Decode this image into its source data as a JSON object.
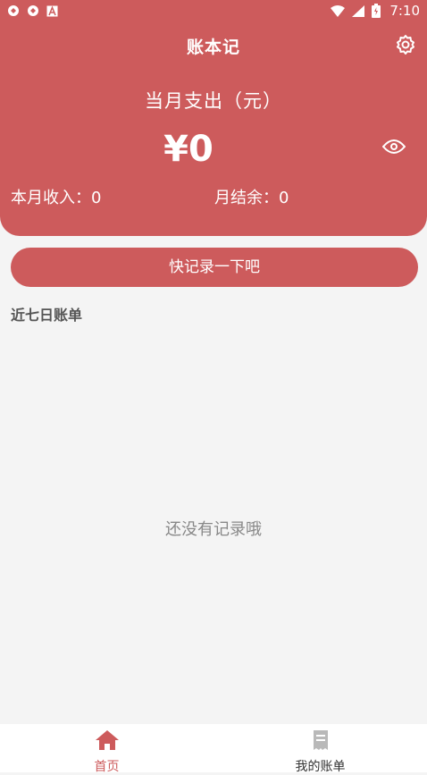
{
  "status_bar": {
    "time": "7:10",
    "left_icons": [
      "sync-app-icon",
      "sync-app-icon",
      "a-app-icon"
    ],
    "right_icons": [
      "wifi-icon",
      "signal-icon",
      "battery-icon"
    ]
  },
  "header": {
    "title": "账本记",
    "expense_label": "当月支出（元）",
    "expense_amount": "¥0",
    "income_label": "本月收入：0",
    "balance_label": "月结余：0",
    "settings_icon": "gear-icon",
    "visibility_icon": "eye-icon"
  },
  "main": {
    "record_button": "快记录一下吧",
    "section_title": "近七日账单",
    "empty_text": "还没有记录哦"
  },
  "tabs": [
    {
      "label": "首页",
      "icon": "home-icon",
      "active": true
    },
    {
      "label": "我的账单",
      "icon": "bill-icon",
      "active": false
    }
  ],
  "colors": {
    "accent": "#cd5b5c",
    "background": "#f4f4f4",
    "tab_inactive_icon": "#b9b9b9"
  }
}
